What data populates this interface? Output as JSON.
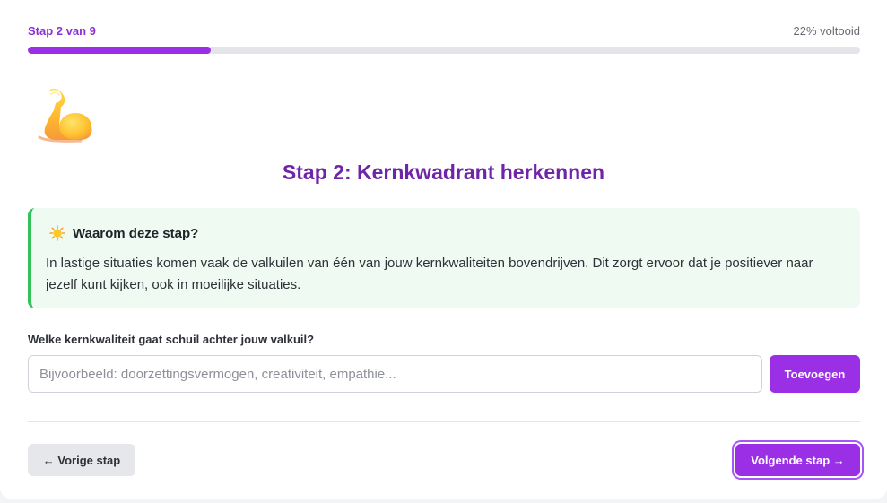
{
  "progress": {
    "step_label": "Stap 2 van 9",
    "percent_label": "22% voltooid",
    "fraction": 0.22,
    "color": "#9a2fe6"
  },
  "hero": {
    "icon": "flexed-biceps-icon",
    "title": "Stap 2: Kernkwadrant herkennen"
  },
  "info": {
    "icon": "sun-icon",
    "title": "Waarom deze stap?",
    "text": "In lastige situaties komen vaak de valkuilen van één van jouw kernkwaliteiten bovendrijven. Dit zorgt ervoor dat je positiever naar jezelf kunt kijken, ook in moeilijke situaties.",
    "accent_color": "#34c05a"
  },
  "question": {
    "label": "Welke kernkwaliteit gaat schuil achter jouw valkuil?",
    "input_value": "",
    "placeholder": "Bijvoorbeeld: doorzettingsvermogen, creativiteit, empathie...",
    "add_label": "Toevoegen"
  },
  "navigation": {
    "prev_label": "← Vorige stap",
    "next_label": "Volgende stap →"
  }
}
